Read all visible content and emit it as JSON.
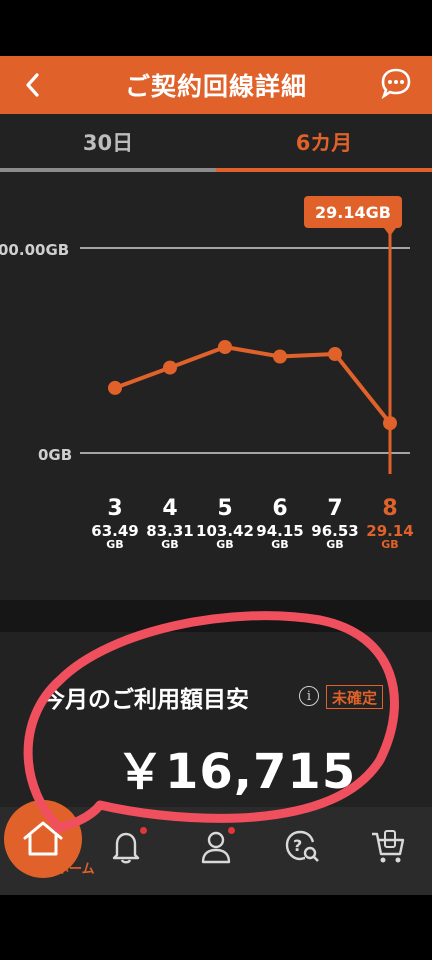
{
  "header": {
    "title": "ご契約回線詳細",
    "back_icon": "chevron-left-icon",
    "chat_icon": "chat-icon"
  },
  "tabs": [
    {
      "label": "30日",
      "active": false
    },
    {
      "label": "6カ月",
      "active": true
    }
  ],
  "chart_data": {
    "type": "line",
    "categories": [
      "3",
      "4",
      "5",
      "6",
      "7",
      "8"
    ],
    "values": [
      63.49,
      83.31,
      103.42,
      94.15,
      96.53,
      29.14
    ],
    "value_labels": [
      "63.49",
      "83.31",
      "103.42",
      "94.15",
      "96.53",
      "29.14"
    ],
    "unit": "GB",
    "y_ticks": [
      "00.00GB",
      "0GB"
    ],
    "ylim": [
      0,
      200
    ],
    "selected_index": 5,
    "tooltip": "29.14GB",
    "grid": true,
    "colors": {
      "line": "#e0622a",
      "grid": "#cfcfcf",
      "selected_text": "#e0622a"
    }
  },
  "usage": {
    "label": "今月のご利用額目安",
    "info_icon": "info-icon",
    "badge": "未確定",
    "amount": "￥16,715"
  },
  "tabbar": {
    "home_label": "ホーム",
    "items": [
      "home-icon",
      "bell-icon",
      "person-icon",
      "help-search-icon",
      "cart-icon"
    ]
  },
  "colors": {
    "accent": "#e0622a",
    "annotation": "#f0505e",
    "background": "#222222"
  }
}
